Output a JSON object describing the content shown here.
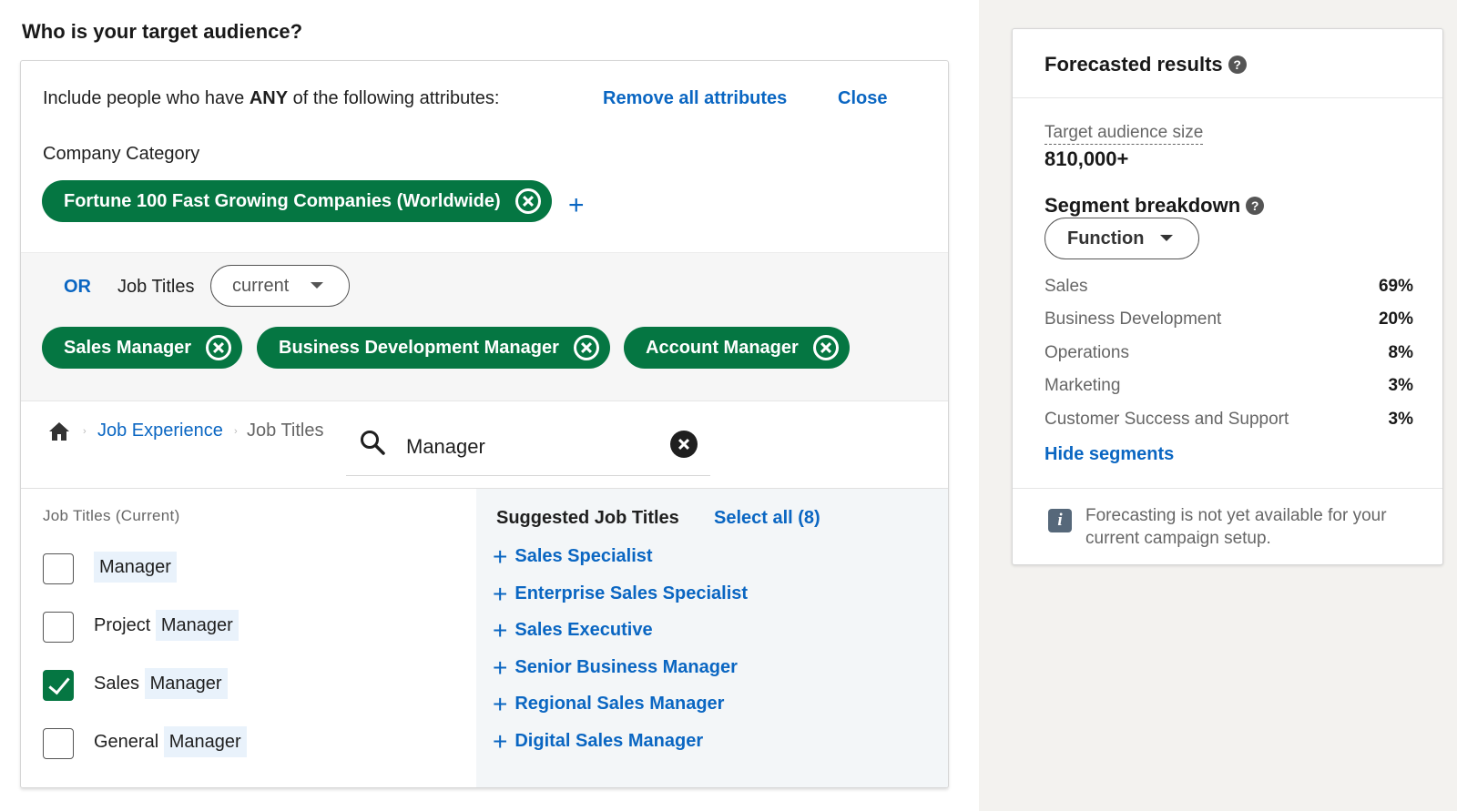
{
  "page": {
    "heading": "Who is your target audience?"
  },
  "attributes": {
    "intro_prefix": "Include people who have ",
    "intro_bold": "ANY",
    "intro_suffix": " of the following attributes:",
    "remove_all_label": "Remove all attributes",
    "close_label": "Close",
    "company_category_label": "Company Category",
    "company_pills": [
      "Fortune 100 Fast Growing Companies (Worldwide)"
    ]
  },
  "or_group": {
    "or_label": "OR",
    "field_label": "Job Titles",
    "dropdown_value": "current",
    "pills": [
      "Sales Manager",
      "Business Development Manager",
      "Account Manager"
    ]
  },
  "browser": {
    "breadcrumb_link": "Job Experience",
    "breadcrumb_current": "Job Titles",
    "search_value": "Manager"
  },
  "job_titles": {
    "title": "Job Titles (Current)",
    "items": [
      {
        "prefix": "",
        "match": "Manager",
        "checked": false
      },
      {
        "prefix": "Project ",
        "match": "Manager",
        "checked": false
      },
      {
        "prefix": "Sales ",
        "match": "Manager",
        "checked": true
      },
      {
        "prefix": "General ",
        "match": "Manager",
        "checked": false
      }
    ]
  },
  "suggested": {
    "title": "Suggested Job Titles",
    "select_all_label": "Select all (8)",
    "items": [
      "Sales Specialist",
      "Enterprise Sales Specialist",
      "Sales Executive",
      "Senior Business Manager",
      "Regional Sales Manager",
      "Digital Sales Manager"
    ]
  },
  "forecast": {
    "title": "Forecasted results",
    "target_size_label": "Target audience size",
    "target_size_value": "810,000+",
    "segment_title": "Segment breakdown",
    "segment_dropdown": "Function",
    "segments": [
      {
        "name": "Sales",
        "pct": "69%"
      },
      {
        "name": "Business Development",
        "pct": "20%"
      },
      {
        "name": "Operations",
        "pct": "8%"
      },
      {
        "name": "Marketing",
        "pct": "3%"
      },
      {
        "name": "Customer Success and Support",
        "pct": "3%"
      }
    ],
    "hide_segments_label": "Hide segments",
    "footer_note": "Forecasting is not yet available for your current campaign setup."
  },
  "colors": {
    "accent_blue": "#0a66c2",
    "pill_green": "#057642"
  }
}
